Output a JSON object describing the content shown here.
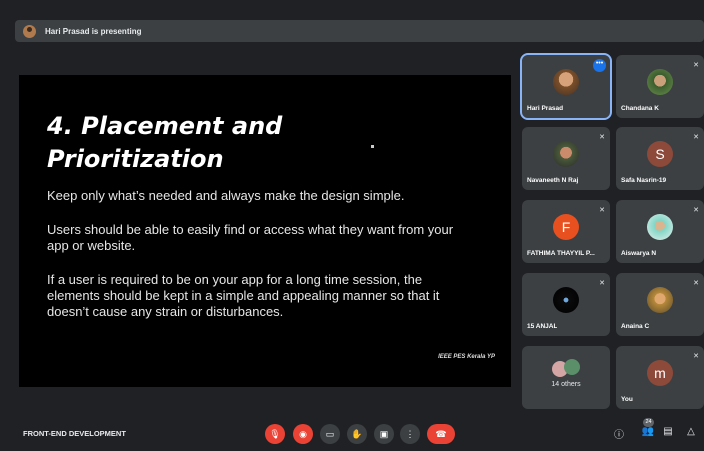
{
  "banner": {
    "text": "Hari Prasad is presenting"
  },
  "slide": {
    "title": "4. Placement and Prioritization",
    "p1": "Keep only what’s needed and always make the design simple.",
    "p2": "Users should be able to easily find or access what they want from your app or website.",
    "p3": "If a user is required to be on your app for a long time session, the elements should be kept in a simple and appealing manner so that it doesn’t cause any strain or disturbances.",
    "credit": "IEEE PES Kerala YP"
  },
  "participants": [
    {
      "name": "Hari Prasad"
    },
    {
      "name": "Chandana K"
    },
    {
      "name": "Navaneeth N Raj"
    },
    {
      "name": "Safa Nasrin-19",
      "initial": "S"
    },
    {
      "name": "FATHIMA THAYYIL P...",
      "initial": "F"
    },
    {
      "name": "Aiswarya N"
    },
    {
      "name": "15 ANJAL"
    },
    {
      "name": "Anaina C"
    },
    {
      "others": "14 others"
    },
    {
      "name": "You",
      "initial": "m"
    }
  ],
  "bottom": {
    "meeting_name": "FRONT-END DEVELOPMENT",
    "people_count": "24"
  },
  "colors": {
    "accent": "#1a73e8",
    "danger": "#ea4335",
    "tile": "#3c4043",
    "bg": "#202124"
  }
}
